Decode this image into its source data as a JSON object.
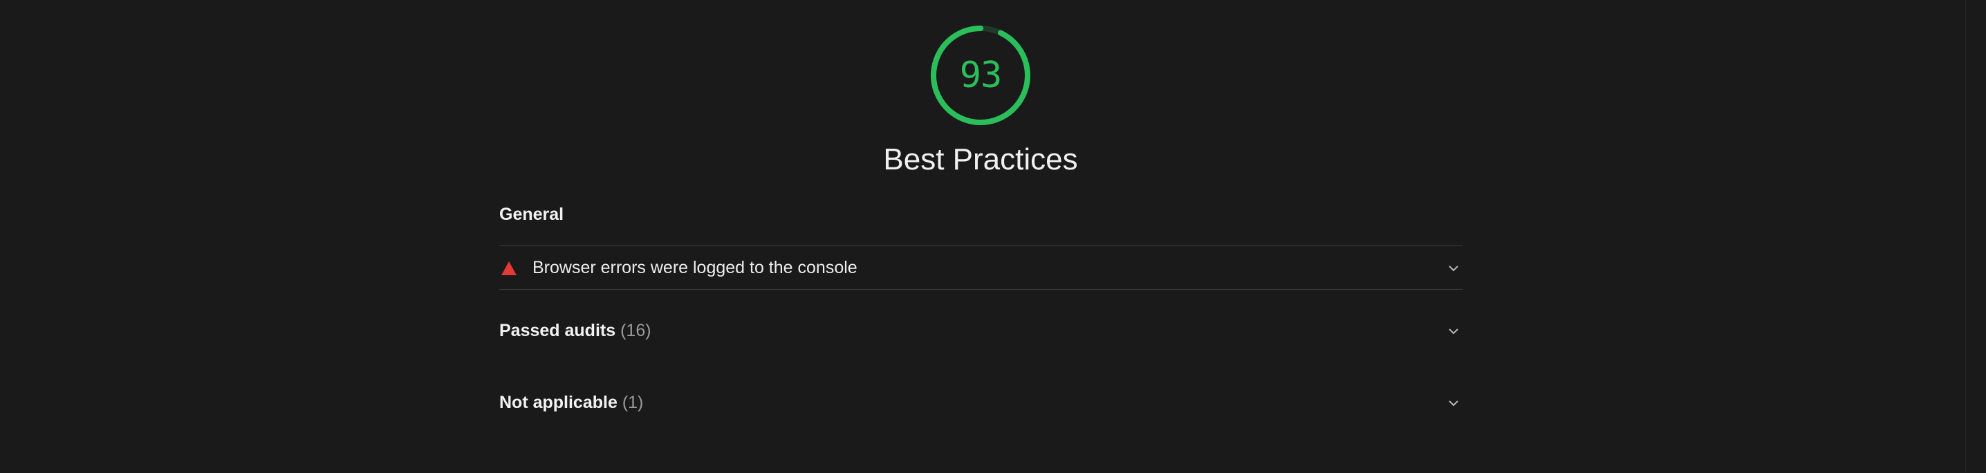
{
  "category": {
    "score": "93",
    "score_fraction": 0.93,
    "score_color": "#2bbf5b",
    "title": "Best Practices"
  },
  "groups": {
    "general": {
      "title": "General",
      "audits": [
        {
          "status": "fail",
          "status_color": "#e53935",
          "icon": "warning-triangle-icon",
          "title": "Browser errors were logged to the console"
        }
      ]
    }
  },
  "sections": {
    "passed": {
      "label": "Passed audits",
      "count": "(16)"
    },
    "not_applicable": {
      "label": "Not applicable",
      "count": "(1)"
    }
  },
  "icons": {
    "expand": "chevron-down-icon"
  }
}
